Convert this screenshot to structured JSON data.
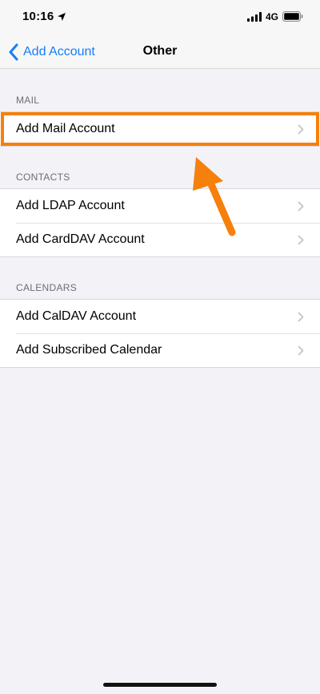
{
  "status_bar": {
    "time": "10:16",
    "network": "4G",
    "icons": [
      "location-arrow-icon",
      "signal-bars-icon",
      "battery-icon"
    ]
  },
  "nav": {
    "back_label": "Add Account",
    "title": "Other"
  },
  "sections": [
    {
      "header": "MAIL",
      "items": [
        {
          "label": "Add Mail Account",
          "highlighted": true
        }
      ]
    },
    {
      "header": "CONTACTS",
      "items": [
        {
          "label": "Add LDAP Account"
        },
        {
          "label": "Add CardDAV Account"
        }
      ]
    },
    {
      "header": "CALENDARS",
      "items": [
        {
          "label": "Add CalDAV Account"
        },
        {
          "label": "Add Subscribed Calendar"
        }
      ]
    }
  ],
  "colors": {
    "accent": "#157efb",
    "annotation": "#f5800b",
    "background": "#f2f2f7"
  }
}
